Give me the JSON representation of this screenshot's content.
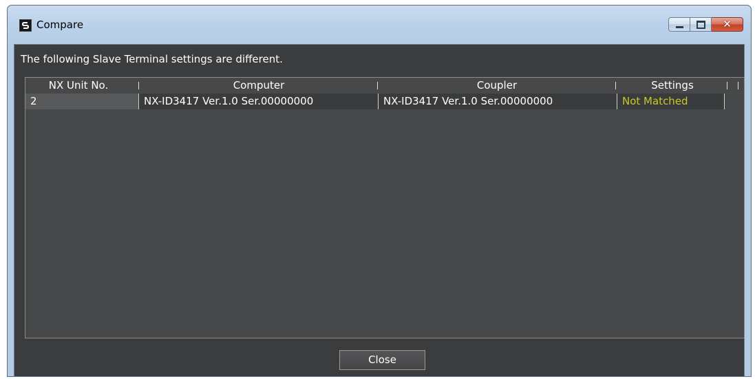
{
  "window": {
    "title": "Compare",
    "controls": {
      "minimize": "minimize-icon",
      "maximize": "maximize-icon",
      "close": "close-icon"
    }
  },
  "message": "The following Slave Terminal settings are different.",
  "table": {
    "columns": [
      "NX Unit No.",
      "Computer",
      "Coupler",
      "Settings"
    ],
    "rows": [
      {
        "unit_no": "2",
        "computer": "NX-ID3417 Ver.1.0 Ser.00000000",
        "coupler": "NX-ID3417 Ver.1.0 Ser.00000000",
        "settings": "Not Matched"
      }
    ]
  },
  "buttons": {
    "close_label": "Close"
  },
  "colors": {
    "client_bg": "#3b3c3e",
    "mismatch_text": "#c9c82a",
    "titlebar": "#b9d1ea"
  }
}
